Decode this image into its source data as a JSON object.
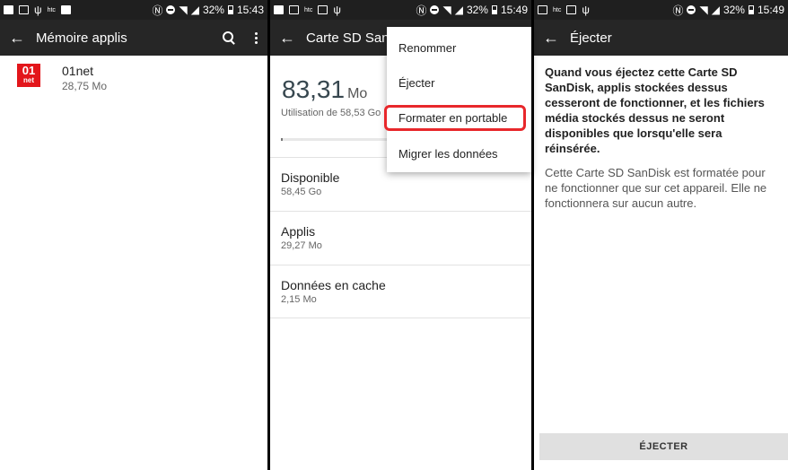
{
  "panel1": {
    "status": {
      "battery": "32%",
      "time": "15:43"
    },
    "title": "Mémoire applis",
    "app": {
      "logo_top": "01",
      "logo_bottom": "net",
      "name": "01net",
      "size": "28,75 Mo"
    }
  },
  "panel2": {
    "status": {
      "battery": "32%",
      "time": "15:49"
    },
    "title": "Carte SD SanDisk",
    "big_value": "83,31",
    "big_unit": "Mo",
    "usage": "Utilisation de 58,53 Go",
    "rows": [
      {
        "title": "Disponible",
        "value": "58,45 Go"
      },
      {
        "title": "Applis",
        "value": "29,27 Mo"
      },
      {
        "title": "Données en cache",
        "value": "2,15 Mo"
      }
    ],
    "menu": [
      "Renommer",
      "Éjecter",
      "Formater en portable",
      "Migrer les données"
    ]
  },
  "panel3": {
    "status": {
      "battery": "32%",
      "time": "15:49"
    },
    "title": "Éjecter",
    "bold_text": "Quand vous éjectez cette Carte SD SanDisk, applis stockées dessus cesseront de fonctionner, et les fichiers média stockés dessus ne seront disponibles que lorsqu'elle sera réinsérée.",
    "normal_text": "Cette Carte SD SanDisk est formatée pour ne fonctionner que sur cet appareil. Elle ne fonctionnera sur aucun autre.",
    "button": "ÉJECTER"
  },
  "colors": {
    "appbar": "#262626",
    "statusbar": "#1f1f1f",
    "highlight": "#e8272b",
    "logo": "#e3161b"
  }
}
